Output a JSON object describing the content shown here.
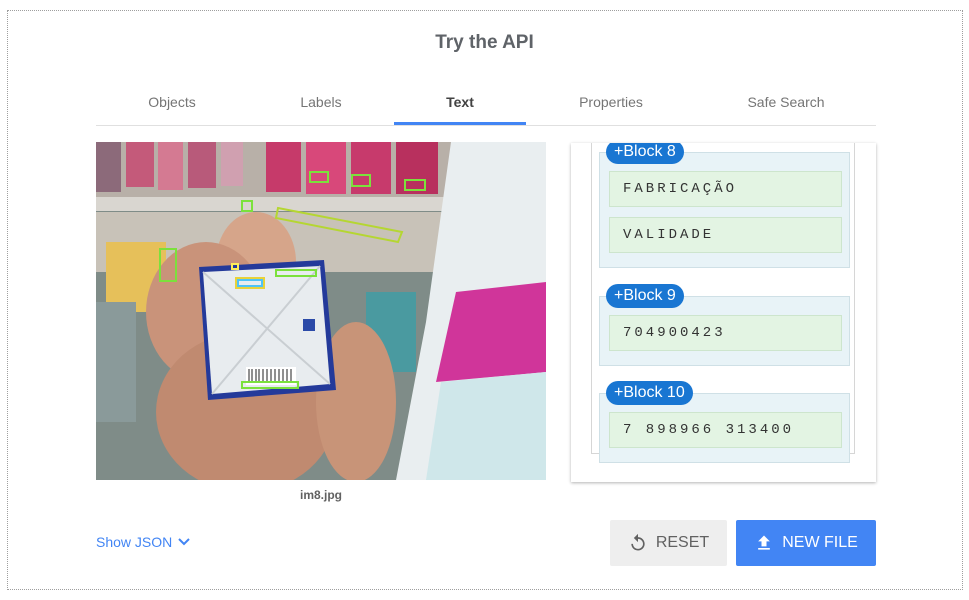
{
  "title": "Try the API",
  "tabs": [
    {
      "label": "Objects"
    },
    {
      "label": "Labels"
    },
    {
      "label": "Text"
    },
    {
      "label": "Properties"
    },
    {
      "label": "Safe Search"
    }
  ],
  "image": {
    "caption": "im8.jpg"
  },
  "blocks": [
    {
      "label": "+Block 8",
      "words": [
        "FABRICAÇÃO",
        "VALIDADE"
      ]
    },
    {
      "label": "+Block 9",
      "words": [
        "704900423"
      ]
    },
    {
      "label": "+Block 10",
      "words": [
        "7 898966 313400"
      ]
    }
  ],
  "footer": {
    "show_json": "Show JSON",
    "reset": "RESET",
    "new_file": "NEW FILE"
  },
  "colors": {
    "accent": "#4285f4",
    "tag": "#1976d2",
    "block_bg": "#e8f3f7",
    "word_bg": "#e3f4e3"
  }
}
